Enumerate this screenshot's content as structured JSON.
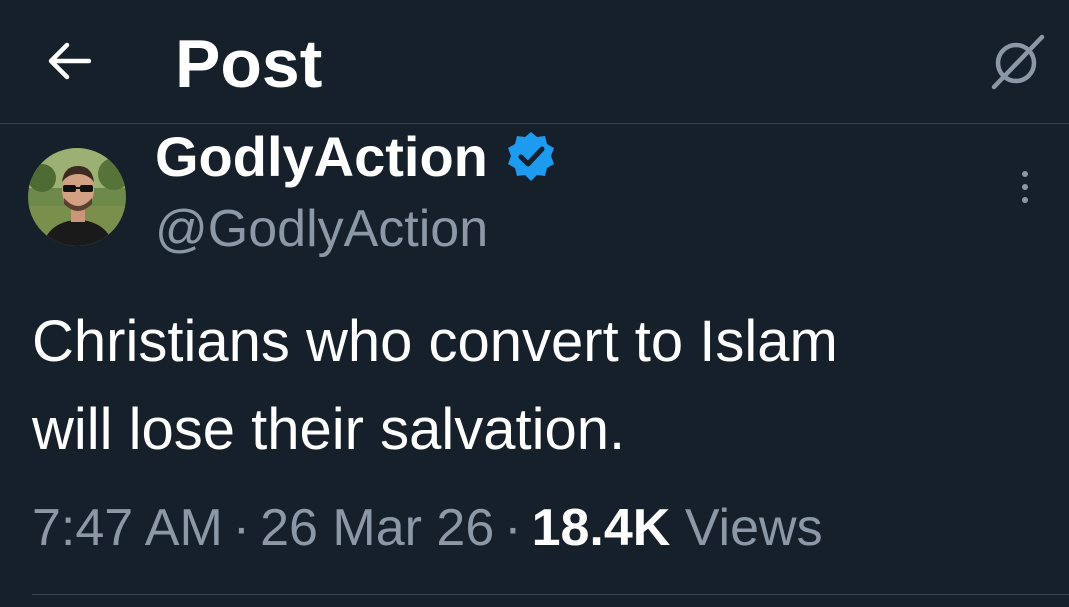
{
  "header": {
    "back_icon": "arrow-left-icon",
    "title": "Post",
    "grok_icon": "grok-icon"
  },
  "post": {
    "author": {
      "display_name": "GodlyAction",
      "handle": "@GodlyAction",
      "verified": true,
      "verified_color": "#1d9bf0",
      "avatar": "avatar-photo"
    },
    "text_lines": [
      "Christians who convert to Islam",
      "will lose their salvation."
    ],
    "time": "7:47 AM",
    "separator": "·",
    "date": "26 Mar 26",
    "views_count": "18.4K",
    "views_label": "Views",
    "more_icon": "more-vertical-icon"
  },
  "colors": {
    "background": "#15202b",
    "primary_text": "#ffffff",
    "secondary_text": "#8b98a5",
    "divider": "#38444d",
    "accent": "#1d9bf0"
  }
}
